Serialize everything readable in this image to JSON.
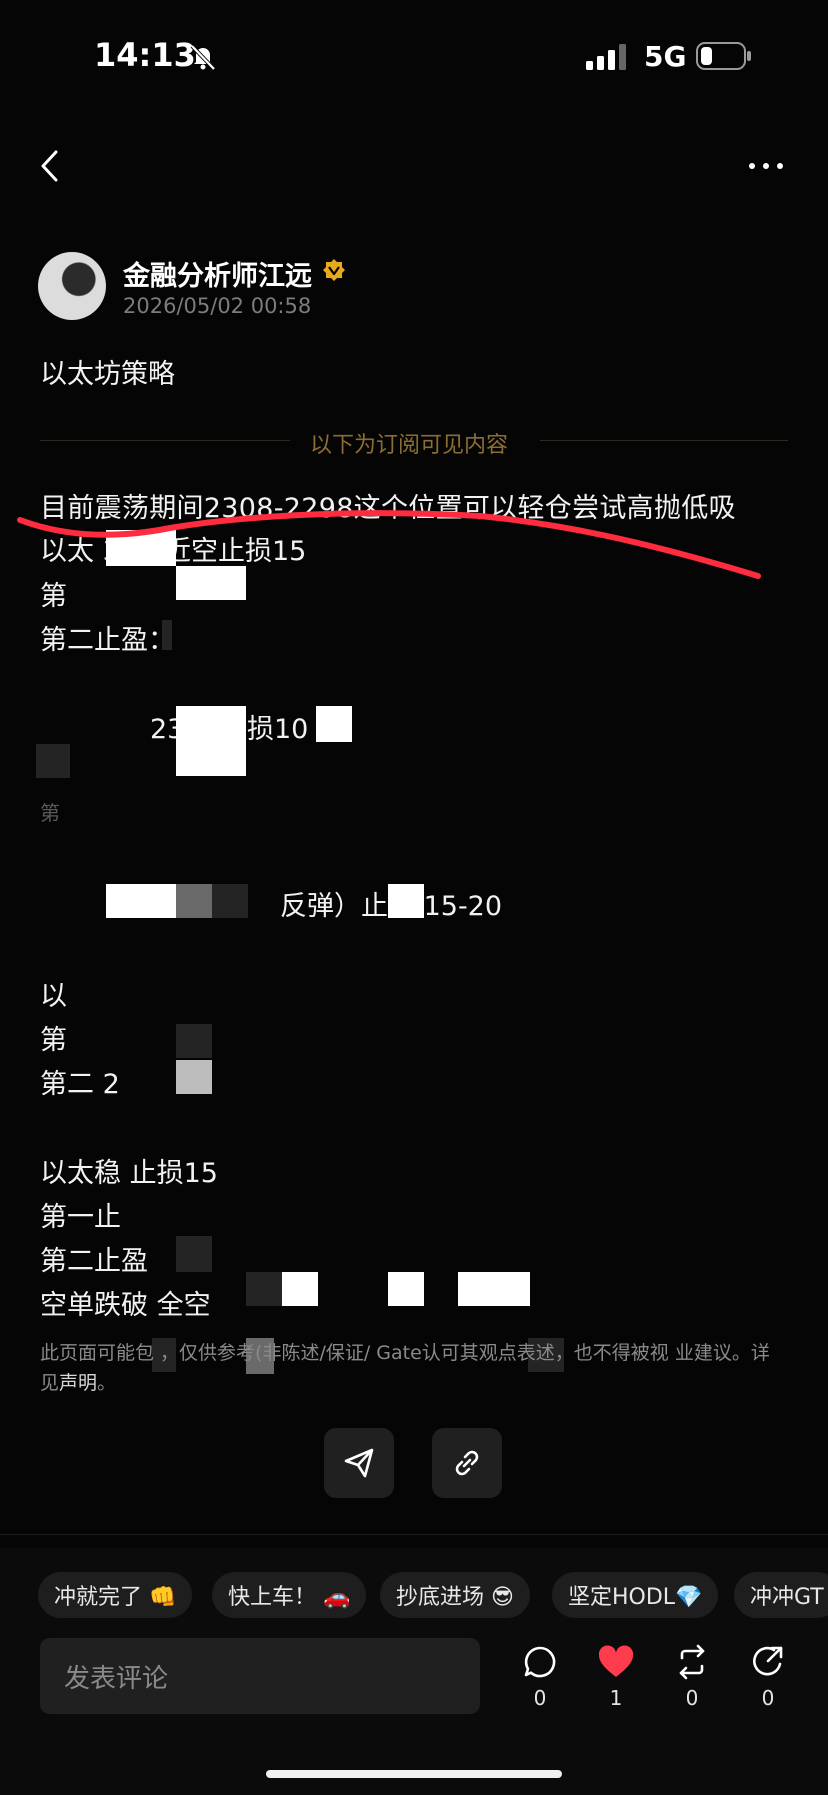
{
  "status_bar": {
    "time": "14:13",
    "network": "5G"
  },
  "post": {
    "author": "金融分析师江远",
    "date": "2026/05/02 00:58",
    "title": "以太坊策略",
    "subscribe_divider": "以下为订阅可见内容",
    "lines": [
      "目前震荡期间2308-2298这个位置可以轻仓尝试高抛低吸",
      "以太 38附近空止损15",
      "第",
      "第二止盈：",
      "23 近止损10",
      "第",
      "反弹）止 盈15-20",
      "以",
      "第",
      "第二 2",
      "以太稳 止损15",
      "第一止",
      "第二止盈",
      "空单跌破 全空"
    ],
    "disclaimer_parts": [
      "此页面可能包 ，仅供参考(非陈述/保证/ Gate认可其观点表述，也不得被视 业建议。详见",
      "声明",
      "。"
    ]
  },
  "reactions": [
    "冲就完了 👊",
    "快上车！ 🚗",
    "抄底进场 😎",
    "坚定HODL💎",
    "冲冲GT"
  ],
  "comment": {
    "placeholder": "发表评论"
  },
  "actions": {
    "comments": "0",
    "likes": "1",
    "reposts": "0",
    "shares": "0"
  },
  "colors": {
    "accent_red": "#ff2b3f",
    "divider_gold": "#8c6e32",
    "background": "#050505"
  }
}
